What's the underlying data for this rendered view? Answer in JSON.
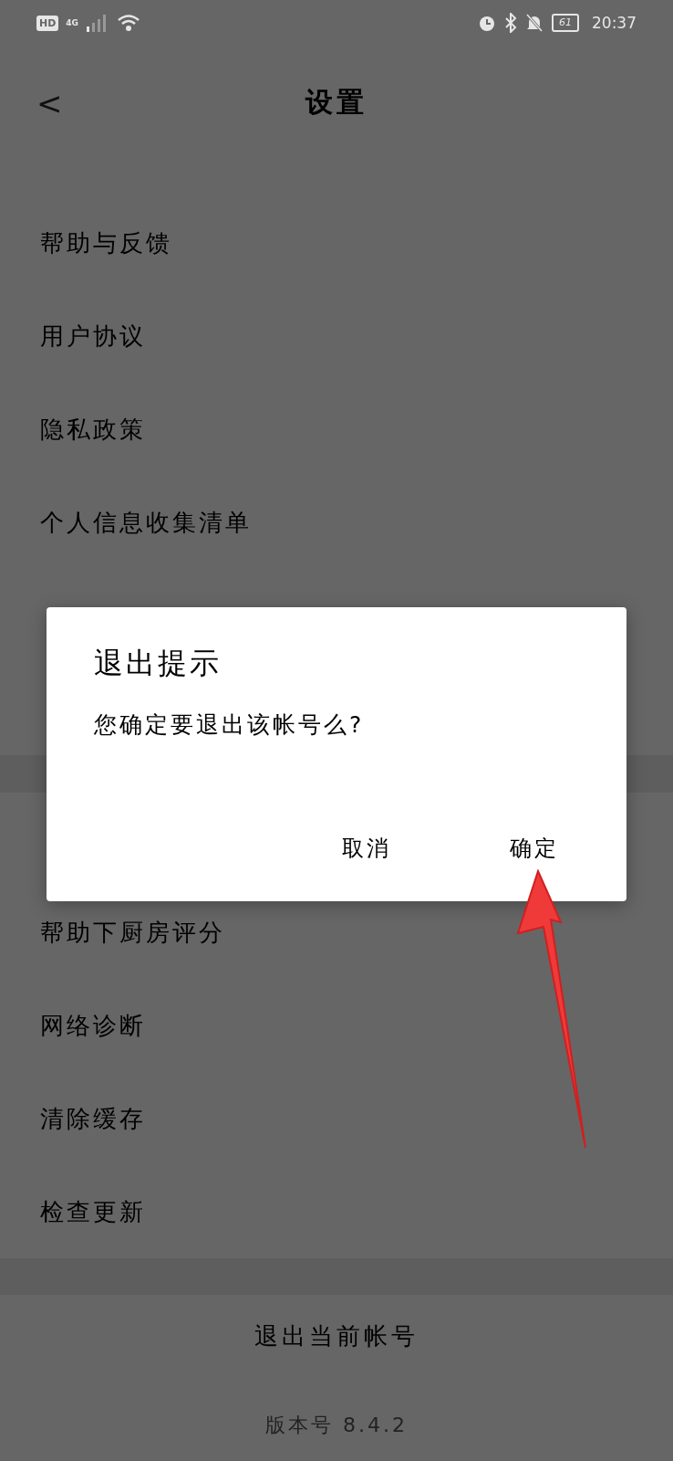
{
  "status_bar": {
    "badge": "HD",
    "time": "20:37",
    "battery": "61",
    "network": "4G"
  },
  "header": {
    "back": "<",
    "title": "设置"
  },
  "groups": [
    {
      "items": [
        "帮助与反馈",
        "用户协议",
        "隐私政策",
        "个人信息收集清单"
      ]
    },
    {
      "items": [
        "帮助下厨房评分",
        "网络诊断",
        "清除缓存",
        "检查更新"
      ]
    }
  ],
  "logout_button": "退出当前帐号",
  "version": "版本号 8.4.2",
  "dialog": {
    "title": "退出提示",
    "message": "您确定要退出该帐号么?",
    "buttons": [
      "取消",
      "确定"
    ]
  }
}
